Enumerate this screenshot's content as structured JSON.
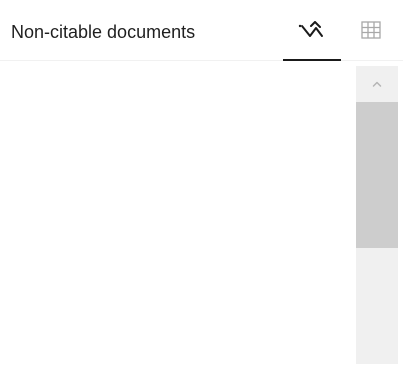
{
  "panel": {
    "title": "Non-citable documents"
  },
  "tabs": [
    {
      "name": "chart-view",
      "icon": "trend-line-icon",
      "active": true
    },
    {
      "name": "table-view",
      "icon": "table-grid-icon",
      "active": false
    }
  ],
  "colors": {
    "text": "#1f1f1f",
    "active_underline": "#1a1a1a",
    "inactive_icon": "#a8a8a8",
    "scroll_track": "#f0f0f0",
    "scroll_thumb": "#cdcdcd"
  },
  "scroll": {
    "thumb_fraction": 0.49,
    "position_fraction": 0
  }
}
